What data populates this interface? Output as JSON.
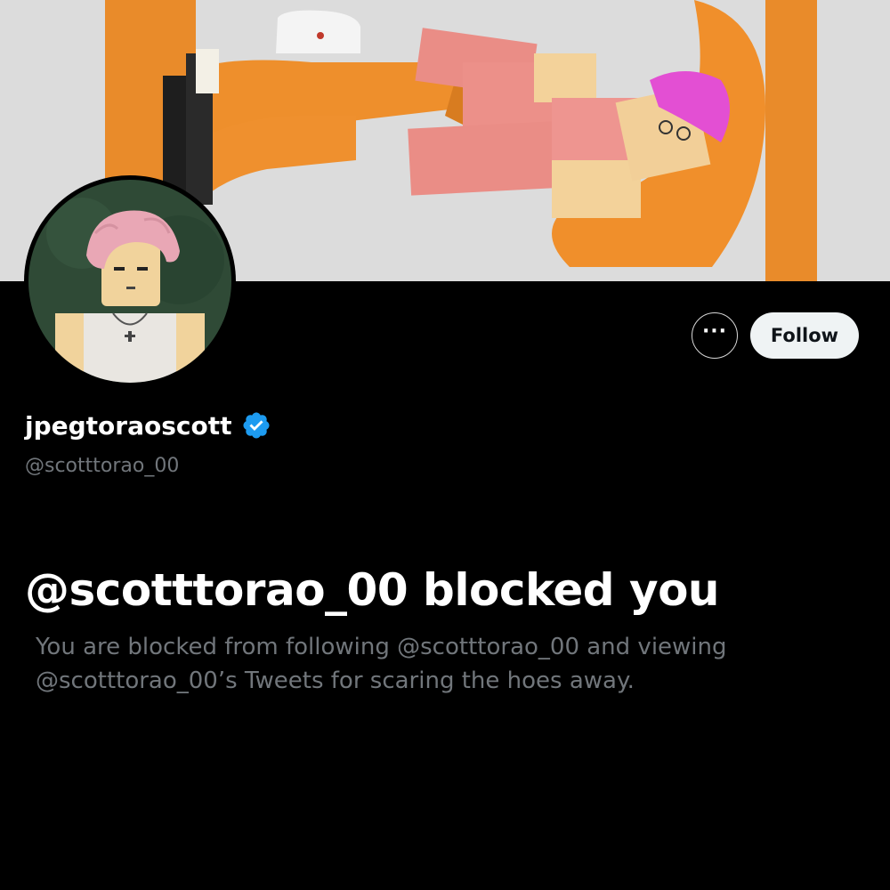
{
  "profile": {
    "display_name": "jpegtoraoscott",
    "handle": "@scotttorao_00",
    "verified": true
  },
  "actions": {
    "more_label": "···",
    "follow_label": "Follow"
  },
  "blocked": {
    "title": "@scotttorao_00 blocked you",
    "description": "You are blocked from following @scotttorao_00 and viewing @scotttorao_00’s Tweets for scaring the hoes away."
  },
  "colors": {
    "background": "#000000",
    "verified_badge": "#1d9bf0",
    "follow_button_bg": "#eff3f4",
    "secondary_text": "#71767b",
    "banner_orange": "#e88a2a"
  },
  "icons": {
    "more": "more-horizontal-icon",
    "verified": "verified-badge-icon"
  }
}
